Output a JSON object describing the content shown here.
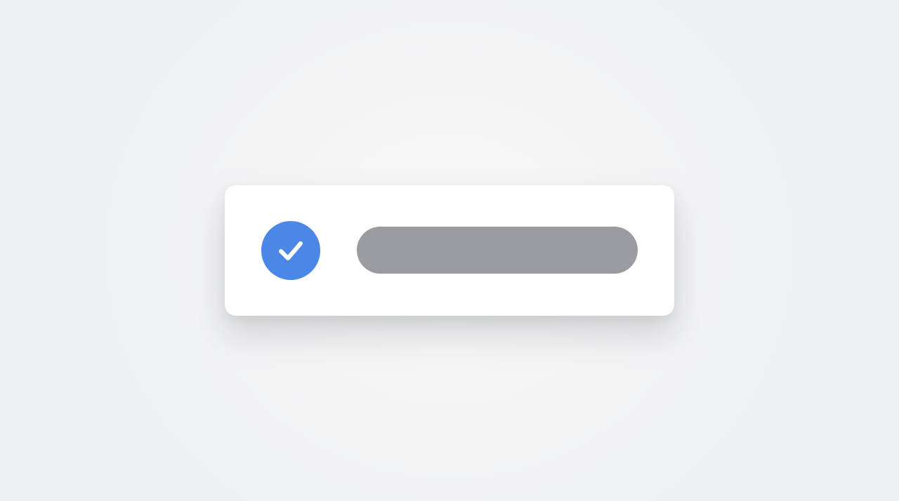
{
  "card": {
    "status": "checked",
    "check_icon": "check-circle-icon",
    "text_label": ""
  },
  "colors": {
    "check_badge": "#4a87e6",
    "check_mark": "#ffffff",
    "text_placeholder": "#9a9ca1",
    "card_background": "#ffffff"
  }
}
